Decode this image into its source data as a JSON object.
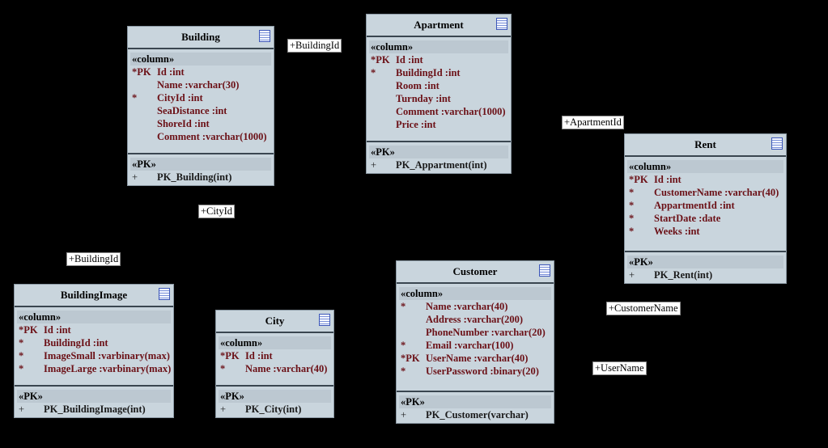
{
  "tables": [
    {
      "id": "building",
      "name": "Building",
      "stereotype": "«column»",
      "columns": [
        {
          "marker": "*PK",
          "text": "Id :int"
        },
        {
          "marker": "",
          "text": "Name :varchar(30)"
        },
        {
          "marker": "*",
          "text": "CityId :int"
        },
        {
          "marker": "",
          "text": "SeaDistance :int"
        },
        {
          "marker": "",
          "text": "ShoreId :int"
        },
        {
          "marker": "",
          "text": "Comment :varchar(1000)"
        }
      ],
      "pk_stereotype": "«PK»",
      "operations": [
        {
          "marker": "+",
          "text": "PK_Building(int)"
        }
      ]
    },
    {
      "id": "apartment",
      "name": "Apartment",
      "stereotype": "«column»",
      "columns": [
        {
          "marker": "*PK",
          "text": "Id :int"
        },
        {
          "marker": "*",
          "text": "BuildingId :int"
        },
        {
          "marker": "",
          "text": "Room :int"
        },
        {
          "marker": "",
          "text": "Turnday :int"
        },
        {
          "marker": "",
          "text": "Comment :varchar(1000)"
        },
        {
          "marker": "",
          "text": "Price :int"
        }
      ],
      "pk_stereotype": "«PK»",
      "operations": [
        {
          "marker": "+",
          "text": "PK_Appartment(int)"
        }
      ]
    },
    {
      "id": "rent",
      "name": "Rent",
      "stereotype": "«column»",
      "columns": [
        {
          "marker": "*PK",
          "text": "Id :int"
        },
        {
          "marker": "*",
          "text": "CustomerName :varchar(40)"
        },
        {
          "marker": "*",
          "text": "AppartmentId :int"
        },
        {
          "marker": "*",
          "text": "StartDate :date"
        },
        {
          "marker": "*",
          "text": "Weeks :int"
        }
      ],
      "pk_stereotype": "«PK»",
      "operations": [
        {
          "marker": "+",
          "text": "PK_Rent(int)"
        }
      ]
    },
    {
      "id": "customer",
      "name": "Customer",
      "stereotype": "«column»",
      "columns": [
        {
          "marker": "*",
          "text": "Name :varchar(40)"
        },
        {
          "marker": "",
          "text": "Address :varchar(200)"
        },
        {
          "marker": "",
          "text": "PhoneNumber :varchar(20)"
        },
        {
          "marker": "*",
          "text": "Email :varchar(100)"
        },
        {
          "marker": "*PK",
          "text": "UserName :varchar(40)"
        },
        {
          "marker": "*",
          "text": "UserPassword :binary(20)"
        }
      ],
      "pk_stereotype": "«PK»",
      "operations": [
        {
          "marker": "+",
          "text": "PK_Customer(varchar)"
        }
      ]
    },
    {
      "id": "buildingimage",
      "name": "BuildingImage",
      "stereotype": "«column»",
      "columns": [
        {
          "marker": "*PK",
          "text": "Id :int"
        },
        {
          "marker": "*",
          "text": "BuildingId :int"
        },
        {
          "marker": "*",
          "text": "ImageSmall :varbinary(max)"
        },
        {
          "marker": "*",
          "text": "ImageLarge :varbinary(max)"
        }
      ],
      "pk_stereotype": "«PK»",
      "operations": [
        {
          "marker": "+",
          "text": "PK_BuildingImage(int)"
        }
      ]
    },
    {
      "id": "city",
      "name": "City",
      "stereotype": "«column»",
      "columns": [
        {
          "marker": "*PK",
          "text": "Id :int"
        },
        {
          "marker": "*",
          "text": "Name :varchar(40)"
        }
      ],
      "pk_stereotype": "«PK»",
      "operations": [
        {
          "marker": "+",
          "text": "PK_City(int)"
        }
      ]
    }
  ],
  "relation_labels": [
    {
      "id": "r1",
      "text": "+BuildingId"
    },
    {
      "id": "r2",
      "text": "+ApartmentId"
    },
    {
      "id": "r3",
      "text": "+CityId"
    },
    {
      "id": "r4",
      "text": "+BuildingId"
    },
    {
      "id": "r5",
      "text": "+CustomerName"
    },
    {
      "id": "r6",
      "text": "+UserName"
    }
  ],
  "colors": {
    "background": "#000000",
    "table_fill": "#c9d5dd",
    "column_text": "#6b1016"
  }
}
